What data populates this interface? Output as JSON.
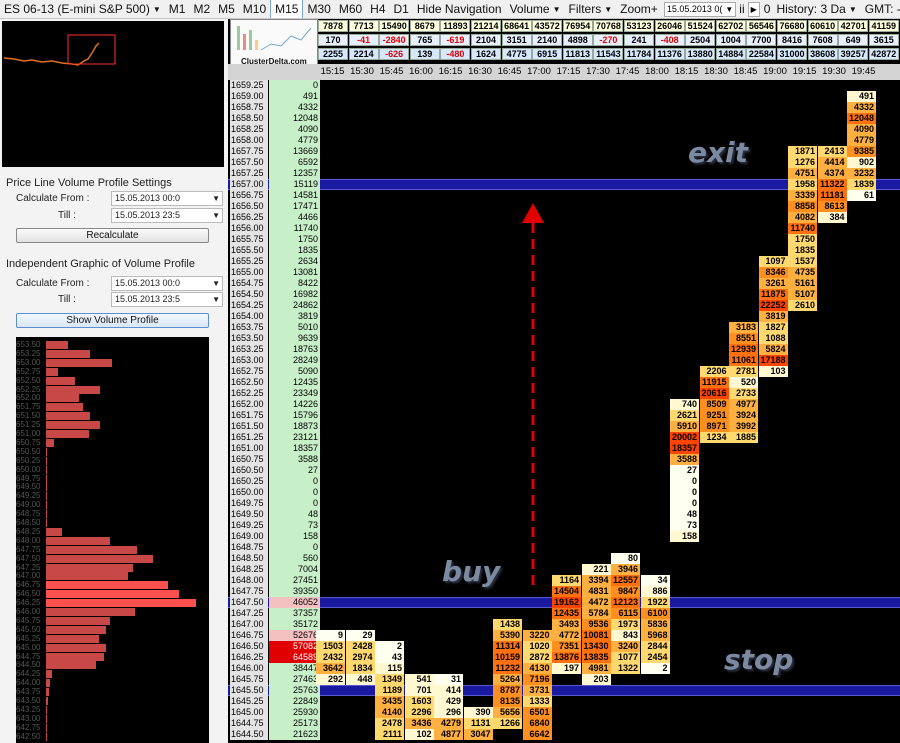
{
  "toolbar": {
    "instrument": "ES 06-13 (E-mini S&P 500)",
    "timeframes": [
      "M1",
      "M2",
      "M5",
      "M10",
      "M15",
      "M30",
      "M60",
      "H4",
      "D1"
    ],
    "active_timeframe": "M15",
    "hide_navigation": "Hide Navigation",
    "volume": "Volume",
    "filters": "Filters",
    "zoom": "Zoom+",
    "date_value": "15.05.2013 0(",
    "ir_label": "ii",
    "zero": "0",
    "history": "History: 3 Da",
    "gmt": "GMT: -"
  },
  "settings1": {
    "title": "Price Line Volume Profile Settings",
    "calc_from_label": "Calculate From :",
    "calc_from_value": "15.05.2013 00:0",
    "till_label": "Till :",
    "till_value": "15.05.2013 23:5",
    "button": "Recalculate"
  },
  "settings2": {
    "title": "Independent Graphic of Volume Profile",
    "calc_from_label": "Calculate From :",
    "calc_from_value": "15.05.2013 00:0",
    "till_label": "Till :",
    "till_value": "15.05.2013 23:5",
    "button": "Show Volume Profile"
  },
  "logo": {
    "text": "ClusterDelta.com"
  },
  "colors": {
    "positive": "#000000",
    "negative": "#e00000",
    "band": "#1a1aa0",
    "profile_bar": "#c84848",
    "profile_hot": "#ff5050"
  },
  "top_rows": {
    "volume": [
      "7878",
      "7713",
      "15490",
      "8679",
      "11893",
      "21214",
      "68641",
      "43572",
      "76954",
      "70768",
      "53123",
      "26046",
      "51524",
      "62702",
      "56546",
      "76680",
      "60610",
      "42701",
      "41159"
    ],
    "delta": [
      "170",
      "-41",
      "-2840",
      "765",
      "-619",
      "2104",
      "3151",
      "2140",
      "4898",
      "-270",
      "241",
      "-408",
      "2504",
      "1004",
      "7700",
      "8416",
      "7608",
      "649",
      "3615"
    ],
    "cum_delta": [
      "2255",
      "2214",
      "-626",
      "139",
      "-480",
      "1624",
      "4775",
      "6915",
      "11813",
      "11543",
      "11784",
      "11376",
      "13880",
      "14884",
      "22584",
      "31000",
      "38608",
      "39257",
      "42872"
    ]
  },
  "times": [
    "15:15",
    "15:30",
    "15:45",
    "16:00",
    "16:15",
    "16:30",
    "16:45",
    "17:00",
    "17:15",
    "17:30",
    "17:45",
    "18:00",
    "18:15",
    "18:30",
    "18:45",
    "19:00",
    "19:15",
    "19:30",
    "19:45"
  ],
  "prices": [
    "1659.25",
    "1659.00",
    "1658.75",
    "1658.50",
    "1658.25",
    "1658.00",
    "1657.75",
    "1657.50",
    "1657.25",
    "1657.00",
    "1656.75",
    "1656.50",
    "1656.25",
    "1656.00",
    "1655.75",
    "1655.50",
    "1655.25",
    "1655.00",
    "1654.75",
    "1654.50",
    "1654.25",
    "1654.00",
    "1653.75",
    "1653.50",
    "1653.25",
    "1653.00",
    "1652.75",
    "1652.50",
    "1652.25",
    "1652.00",
    "1651.75",
    "1651.50",
    "1651.25",
    "1651.00",
    "1650.75",
    "1650.50",
    "1650.25",
    "1650.00",
    "1649.75",
    "1649.50",
    "1649.25",
    "1649.00",
    "1648.75",
    "1648.50",
    "1648.25",
    "1648.00",
    "1647.75",
    "1647.50",
    "1647.25",
    "1647.00",
    "1646.75",
    "1646.50",
    "1646.25",
    "1646.00",
    "1645.75",
    "1645.50",
    "1645.25",
    "1645.00",
    "1644.75",
    "1644.50"
  ],
  "total_volumes": [
    "0",
    "491",
    "4332",
    "12048",
    "4090",
    "4779",
    "13669",
    "6592",
    "12357",
    "15119",
    "14581",
    "17471",
    "4466",
    "11740",
    "1750",
    "1835",
    "2634",
    "13081",
    "8422",
    "16982",
    "24862",
    "3819",
    "5010",
    "9639",
    "18763",
    "28249",
    "5090",
    "12435",
    "23349",
    "14226",
    "15796",
    "18873",
    "23121",
    "18357",
    "3588",
    "27",
    "0",
    "0",
    "0",
    "48",
    "73",
    "158",
    "0",
    "560",
    "7004",
    "27451",
    "39350",
    "46052",
    "37357",
    "35172",
    "52676",
    "57082",
    "64589",
    "38447",
    "27463",
    "25763",
    "22849",
    "25930",
    "25173",
    "21623"
  ],
  "bands": [
    "1657.00",
    "1647.50",
    "1645.50"
  ],
  "clusters": [
    {
      "price": "1659.00",
      "col": 18,
      "value": "491"
    },
    {
      "price": "1658.75",
      "col": 18,
      "value": "4332"
    },
    {
      "price": "1658.50",
      "col": 18,
      "value": "12048"
    },
    {
      "price": "1658.25",
      "col": 18,
      "value": "4090"
    },
    {
      "price": "1658.00",
      "col": 18,
      "value": "4779"
    },
    {
      "price": "1657.75",
      "col": 16,
      "value": "1871"
    },
    {
      "price": "1657.75",
      "col": 17,
      "value": "2413"
    },
    {
      "price": "1657.75",
      "col": 18,
      "value": "9385"
    },
    {
      "price": "1657.50",
      "col": 16,
      "value": "1276"
    },
    {
      "price": "1657.50",
      "col": 17,
      "value": "4414"
    },
    {
      "price": "1657.50",
      "col": 18,
      "value": "902"
    },
    {
      "price": "1657.25",
      "col": 16,
      "value": "4751"
    },
    {
      "price": "1657.25",
      "col": 17,
      "value": "4374"
    },
    {
      "price": "1657.25",
      "col": 18,
      "value": "3232"
    },
    {
      "price": "1657.00",
      "col": 16,
      "value": "1958"
    },
    {
      "price": "1657.00",
      "col": 17,
      "value": "11322"
    },
    {
      "price": "1657.00",
      "col": 18,
      "value": "1839"
    },
    {
      "price": "1656.75",
      "col": 16,
      "value": "3339"
    },
    {
      "price": "1656.75",
      "col": 17,
      "value": "11181"
    },
    {
      "price": "1656.75",
      "col": 18,
      "value": "61"
    },
    {
      "price": "1656.50",
      "col": 16,
      "value": "8858"
    },
    {
      "price": "1656.50",
      "col": 17,
      "value": "8613"
    },
    {
      "price": "1656.25",
      "col": 16,
      "value": "4082"
    },
    {
      "price": "1656.25",
      "col": 17,
      "value": "384"
    },
    {
      "price": "1656.00",
      "col": 16,
      "value": "11740"
    },
    {
      "price": "1655.75",
      "col": 16,
      "value": "1750"
    },
    {
      "price": "1655.50",
      "col": 16,
      "value": "1835"
    },
    {
      "price": "1655.25",
      "col": 15,
      "value": "1097"
    },
    {
      "price": "1655.25",
      "col": 16,
      "value": "1537"
    },
    {
      "price": "1655.00",
      "col": 15,
      "value": "8346"
    },
    {
      "price": "1655.00",
      "col": 16,
      "value": "4735"
    },
    {
      "price": "1654.75",
      "col": 15,
      "value": "3261"
    },
    {
      "price": "1654.75",
      "col": 16,
      "value": "5161"
    },
    {
      "price": "1654.50",
      "col": 15,
      "value": "11875"
    },
    {
      "price": "1654.50",
      "col": 16,
      "value": "5107"
    },
    {
      "price": "1654.25",
      "col": 15,
      "value": "22252"
    },
    {
      "price": "1654.25",
      "col": 16,
      "value": "2610"
    },
    {
      "price": "1654.00",
      "col": 15,
      "value": "3819"
    },
    {
      "price": "1653.75",
      "col": 14,
      "value": "3183"
    },
    {
      "price": "1653.75",
      "col": 15,
      "value": "1827"
    },
    {
      "price": "1653.50",
      "col": 14,
      "value": "8551"
    },
    {
      "price": "1653.50",
      "col": 15,
      "value": "1088"
    },
    {
      "price": "1653.25",
      "col": 14,
      "value": "12939"
    },
    {
      "price": "1653.25",
      "col": 15,
      "value": "5824"
    },
    {
      "price": "1653.00",
      "col": 14,
      "value": "11061"
    },
    {
      "price": "1653.00",
      "col": 15,
      "value": "17188"
    },
    {
      "price": "1652.75",
      "col": 13,
      "value": "2206"
    },
    {
      "price": "1652.75",
      "col": 14,
      "value": "2781"
    },
    {
      "price": "1652.75",
      "col": 15,
      "value": "103"
    },
    {
      "price": "1652.50",
      "col": 13,
      "value": "11915"
    },
    {
      "price": "1652.50",
      "col": 14,
      "value": "520"
    },
    {
      "price": "1652.25",
      "col": 13,
      "value": "20616"
    },
    {
      "price": "1652.25",
      "col": 14,
      "value": "2733"
    },
    {
      "price": "1652.00",
      "col": 12,
      "value": "740"
    },
    {
      "price": "1652.00",
      "col": 13,
      "value": "8509"
    },
    {
      "price": "1652.00",
      "col": 14,
      "value": "4977"
    },
    {
      "price": "1651.75",
      "col": 12,
      "value": "2621"
    },
    {
      "price": "1651.75",
      "col": 13,
      "value": "9251"
    },
    {
      "price": "1651.75",
      "col": 14,
      "value": "3924"
    },
    {
      "price": "1651.50",
      "col": 12,
      "value": "5910"
    },
    {
      "price": "1651.50",
      "col": 13,
      "value": "8971"
    },
    {
      "price": "1651.50",
      "col": 14,
      "value": "3992"
    },
    {
      "price": "1651.25",
      "col": 12,
      "value": "20002"
    },
    {
      "price": "1651.25",
      "col": 13,
      "value": "1234"
    },
    {
      "price": "1651.25",
      "col": 14,
      "value": "1885"
    },
    {
      "price": "1651.00",
      "col": 12,
      "value": "18357"
    },
    {
      "price": "1650.75",
      "col": 12,
      "value": "3588"
    },
    {
      "price": "1650.50",
      "col": 12,
      "value": "27"
    },
    {
      "price": "1650.25",
      "col": 12,
      "value": "0"
    },
    {
      "price": "1650.00",
      "col": 12,
      "value": "0"
    },
    {
      "price": "1649.75",
      "col": 12,
      "value": "0"
    },
    {
      "price": "1649.50",
      "col": 12,
      "value": "48"
    },
    {
      "price": "1649.25",
      "col": 12,
      "value": "73"
    },
    {
      "price": "1649.00",
      "col": 12,
      "value": "158"
    },
    {
      "price": "1648.50",
      "col": 10,
      "value": "80"
    },
    {
      "price": "1648.25",
      "col": 9,
      "value": "221"
    },
    {
      "price": "1648.25",
      "col": 10,
      "value": "3946"
    },
    {
      "price": "1648.00",
      "col": 8,
      "value": "1164"
    },
    {
      "price": "1648.00",
      "col": 9,
      "value": "3394"
    },
    {
      "price": "1648.00",
      "col": 10,
      "value": "12557"
    },
    {
      "price": "1648.00",
      "col": 11,
      "value": "34"
    },
    {
      "price": "1647.75",
      "col": 8,
      "value": "14504"
    },
    {
      "price": "1647.75",
      "col": 9,
      "value": "4831"
    },
    {
      "price": "1647.75",
      "col": 10,
      "value": "9847"
    },
    {
      "price": "1647.75",
      "col": 11,
      "value": "886"
    },
    {
      "price": "1647.50",
      "col": 8,
      "value": "19162"
    },
    {
      "price": "1647.50",
      "col": 9,
      "value": "4472"
    },
    {
      "price": "1647.50",
      "col": 10,
      "value": "12123"
    },
    {
      "price": "1647.50",
      "col": 11,
      "value": "1922"
    },
    {
      "price": "1647.25",
      "col": 8,
      "value": "12435"
    },
    {
      "price": "1647.25",
      "col": 9,
      "value": "5784"
    },
    {
      "price": "1647.25",
      "col": 10,
      "value": "6115"
    },
    {
      "price": "1647.25",
      "col": 11,
      "value": "6100"
    },
    {
      "price": "1647.00",
      "col": 6,
      "value": "1438"
    },
    {
      "price": "1647.00",
      "col": 8,
      "value": "3493"
    },
    {
      "price": "1647.00",
      "col": 9,
      "value": "9536"
    },
    {
      "price": "1647.00",
      "col": 10,
      "value": "1973"
    },
    {
      "price": "1647.00",
      "col": 11,
      "value": "5836"
    },
    {
      "price": "1646.75",
      "col": 0,
      "value": "9"
    },
    {
      "price": "1646.75",
      "col": 1,
      "value": "29"
    },
    {
      "price": "1646.75",
      "col": 6,
      "value": "5390"
    },
    {
      "price": "1646.75",
      "col": 7,
      "value": "3220"
    },
    {
      "price": "1646.75",
      "col": 8,
      "value": "4772"
    },
    {
      "price": "1646.75",
      "col": 9,
      "value": "10081"
    },
    {
      "price": "1646.75",
      "col": 10,
      "value": "843"
    },
    {
      "price": "1646.75",
      "col": 11,
      "value": "5968"
    },
    {
      "price": "1646.50",
      "col": 0,
      "value": "1503"
    },
    {
      "price": "1646.50",
      "col": 1,
      "value": "2428"
    },
    {
      "price": "1646.50",
      "col": 2,
      "value": "2"
    },
    {
      "price": "1646.50",
      "col": 6,
      "value": "11314"
    },
    {
      "price": "1646.50",
      "col": 7,
      "value": "1020"
    },
    {
      "price": "1646.50",
      "col": 8,
      "value": "7351"
    },
    {
      "price": "1646.50",
      "col": 9,
      "value": "13430"
    },
    {
      "price": "1646.50",
      "col": 10,
      "value": "3240"
    },
    {
      "price": "1646.50",
      "col": 11,
      "value": "2844"
    },
    {
      "price": "1646.25",
      "col": 0,
      "value": "2432"
    },
    {
      "price": "1646.25",
      "col": 1,
      "value": "2974"
    },
    {
      "price": "1646.25",
      "col": 2,
      "value": "43"
    },
    {
      "price": "1646.25",
      "col": 6,
      "value": "10159"
    },
    {
      "price": "1646.25",
      "col": 7,
      "value": "2872"
    },
    {
      "price": "1646.25",
      "col": 8,
      "value": "13876"
    },
    {
      "price": "1646.25",
      "col": 9,
      "value": "13835"
    },
    {
      "price": "1646.25",
      "col": 10,
      "value": "1077"
    },
    {
      "price": "1646.25",
      "col": 11,
      "value": "2454"
    },
    {
      "price": "1646.00",
      "col": 0,
      "value": "3642"
    },
    {
      "price": "1646.00",
      "col": 1,
      "value": "1834"
    },
    {
      "price": "1646.00",
      "col": 2,
      "value": "115"
    },
    {
      "price": "1646.00",
      "col": 6,
      "value": "11232"
    },
    {
      "price": "1646.00",
      "col": 7,
      "value": "4130"
    },
    {
      "price": "1646.00",
      "col": 8,
      "value": "197"
    },
    {
      "price": "1646.00",
      "col": 9,
      "value": "4981"
    },
    {
      "price": "1646.00",
      "col": 10,
      "value": "1322"
    },
    {
      "price": "1646.00",
      "col": 11,
      "value": "2"
    },
    {
      "price": "1645.75",
      "col": 0,
      "value": "292"
    },
    {
      "price": "1645.75",
      "col": 1,
      "value": "448"
    },
    {
      "price": "1645.75",
      "col": 2,
      "value": "1349"
    },
    {
      "price": "1645.75",
      "col": 3,
      "value": "541"
    },
    {
      "price": "1645.75",
      "col": 4,
      "value": "31"
    },
    {
      "price": "1645.75",
      "col": 6,
      "value": "5264"
    },
    {
      "price": "1645.75",
      "col": 7,
      "value": "7196"
    },
    {
      "price": "1645.75",
      "col": 9,
      "value": "203"
    },
    {
      "price": "1645.50",
      "col": 2,
      "value": "1189"
    },
    {
      "price": "1645.50",
      "col": 3,
      "value": "701"
    },
    {
      "price": "1645.50",
      "col": 4,
      "value": "414"
    },
    {
      "price": "1645.50",
      "col": 6,
      "value": "8787"
    },
    {
      "price": "1645.50",
      "col": 7,
      "value": "3731"
    },
    {
      "price": "1645.25",
      "col": 2,
      "value": "3435"
    },
    {
      "price": "1645.25",
      "col": 3,
      "value": "1603"
    },
    {
      "price": "1645.25",
      "col": 4,
      "value": "429"
    },
    {
      "price": "1645.25",
      "col": 6,
      "value": "8135"
    },
    {
      "price": "1645.25",
      "col": 7,
      "value": "1333"
    },
    {
      "price": "1645.00",
      "col": 2,
      "value": "4140"
    },
    {
      "price": "1645.00",
      "col": 3,
      "value": "2296"
    },
    {
      "price": "1645.00",
      "col": 4,
      "value": "296"
    },
    {
      "price": "1645.00",
      "col": 5,
      "value": "390"
    },
    {
      "price": "1645.00",
      "col": 6,
      "value": "5656"
    },
    {
      "price": "1645.00",
      "col": 7,
      "value": "6501"
    },
    {
      "price": "1644.75",
      "col": 2,
      "value": "2478"
    },
    {
      "price": "1644.75",
      "col": 3,
      "value": "3436"
    },
    {
      "price": "1644.75",
      "col": 4,
      "value": "4279"
    },
    {
      "price": "1644.75",
      "col": 5,
      "value": "1131"
    },
    {
      "price": "1644.75",
      "col": 6,
      "value": "1266"
    },
    {
      "price": "1644.75",
      "col": 7,
      "value": "6840"
    },
    {
      "price": "1644.50",
      "col": 2,
      "value": "2111"
    },
    {
      "price": "1644.50",
      "col": 3,
      "value": "102"
    },
    {
      "price": "1644.50",
      "col": 4,
      "value": "4877"
    },
    {
      "price": "1644.50",
      "col": 5,
      "value": "3047"
    },
    {
      "price": "1644.50",
      "col": 7,
      "value": "6642"
    }
  ],
  "annotations": {
    "exit": "exit",
    "buy": "buy",
    "stop": "stop"
  },
  "profile": {
    "labels": [
      "653.50",
      "653.25",
      "653.00",
      "652.75",
      "652.50",
      "652.25",
      "652.00",
      "651.75",
      "651.50",
      "651.25",
      "651.00",
      "650.75",
      "650.50",
      "650.25",
      "650.00",
      "649.75",
      "649.50",
      "649.25",
      "649.00",
      "648.75",
      "648.50",
      "648.25",
      "648.00",
      "647.75",
      "647.50",
      "647.25",
      "647.00",
      "646.75",
      "646.50",
      "646.25",
      "646.00",
      "645.75",
      "645.50",
      "645.25",
      "645.00",
      "644.75",
      "644.50",
      "644.25",
      "644.00",
      "643.75",
      "643.50",
      "643.25",
      "643.00",
      "642.75",
      "642.50"
    ],
    "values": [
      9639,
      18763,
      28249,
      5090,
      12435,
      23349,
      14226,
      15796,
      18873,
      23121,
      18357,
      3588,
      27,
      0,
      0,
      0,
      48,
      73,
      158,
      0,
      560,
      7004,
      27451,
      39350,
      46052,
      37357,
      35172,
      52676,
      57082,
      64589,
      38447,
      27463,
      25763,
      22849,
      25930,
      25173,
      21623,
      2500,
      1800,
      1200,
      900,
      600,
      400,
      200,
      100
    ]
  }
}
